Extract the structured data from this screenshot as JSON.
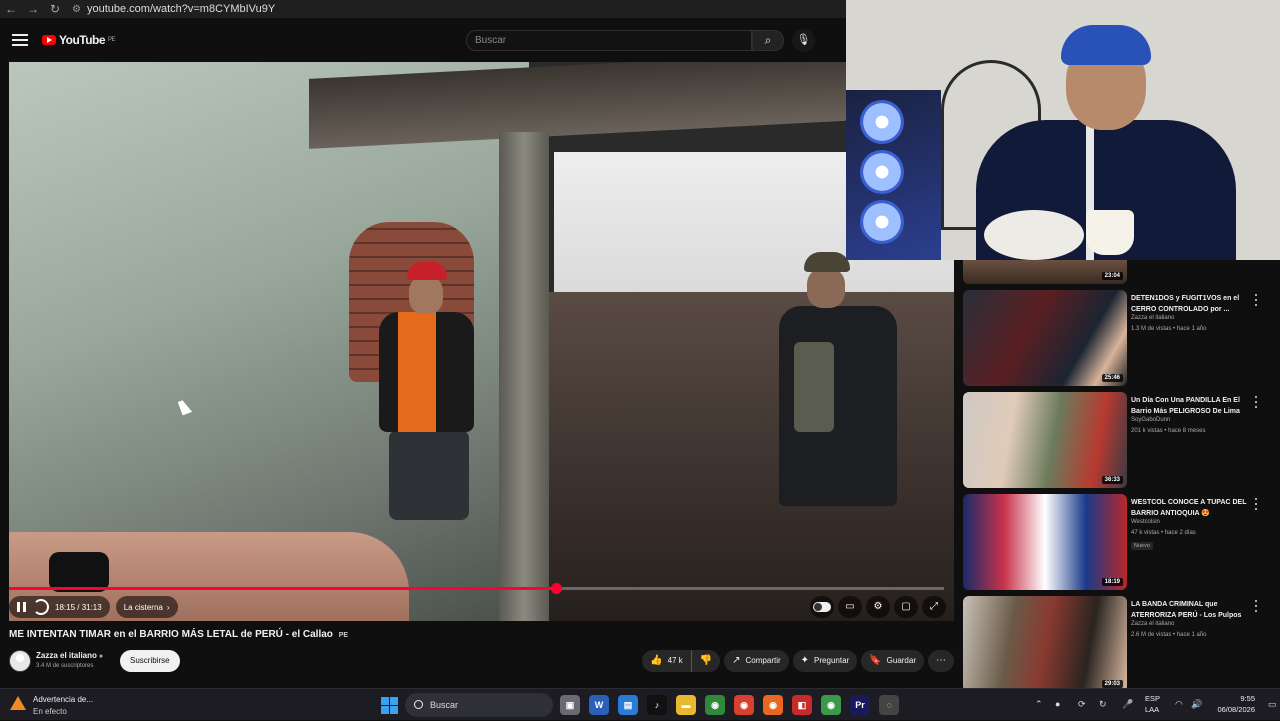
{
  "browser": {
    "url": "youtube.com/watch?v=m8CYMbIVu9Y"
  },
  "header": {
    "logo_text": "YouTube",
    "logo_region": "PE",
    "search_placeholder": "Buscar"
  },
  "player": {
    "time": "18:15 / 31:13",
    "chapter": "La cisterna",
    "chapter_arrow": "›",
    "progress": 0.585
  },
  "video": {
    "title": "ME INTENTAN TIMAR en el BARRIO MÁS LETAL de PERÚ - el Callao",
    "title_flag": "PE",
    "channel": "Zazza el italiano",
    "subscribers": "3.4 M de suscriptores",
    "subscribe_label": "Suscribirse",
    "likes": "47 k",
    "share_label": "Compartir",
    "ask_label": "Preguntar",
    "save_label": "Guardar"
  },
  "sidebar": {
    "partial_duration": "23:04",
    "items": [
      {
        "title": "DETEN1DOS y FUGIT1VOS en el CERRO CONTROLADO por ...",
        "channel": "Zazza el italiano",
        "meta": "1.3 M de vistas • hace 1 año",
        "duration": "25:46",
        "badge": ""
      },
      {
        "title": "Un Día Con Una PANDILLA En El Barrio Más PELIGROSO De Lima",
        "channel": "SoyGaboDunn",
        "meta": "201 k vistas • hace 8 meses",
        "duration": "36:33",
        "badge": ""
      },
      {
        "title": "WESTCOL CONOCE A TUPAC DEL BARRIO ANTIOQUIA 😍",
        "channel": "Westcolsin",
        "meta": "47 k vistas • hace 2 días",
        "duration": "18:19",
        "badge": "Nuevo"
      },
      {
        "title": "LA BANDA CRIMINAL que ATERRORIZA PERÚ - Los Pulpos",
        "channel": "Zazza el italiano",
        "meta": "2.6 M de vistas • hace 1 año",
        "duration": "29:03",
        "badge": ""
      }
    ]
  },
  "taskbar": {
    "weather_title": "Advertencia de...",
    "weather_sub": "En efecto",
    "search_label": "Buscar",
    "lang1": "ESP",
    "lang2": "LAA",
    "time": "9:55",
    "date": "06/08/2026"
  },
  "colors": {
    "accent": "#ff0033",
    "background": "#0f0f0f"
  }
}
